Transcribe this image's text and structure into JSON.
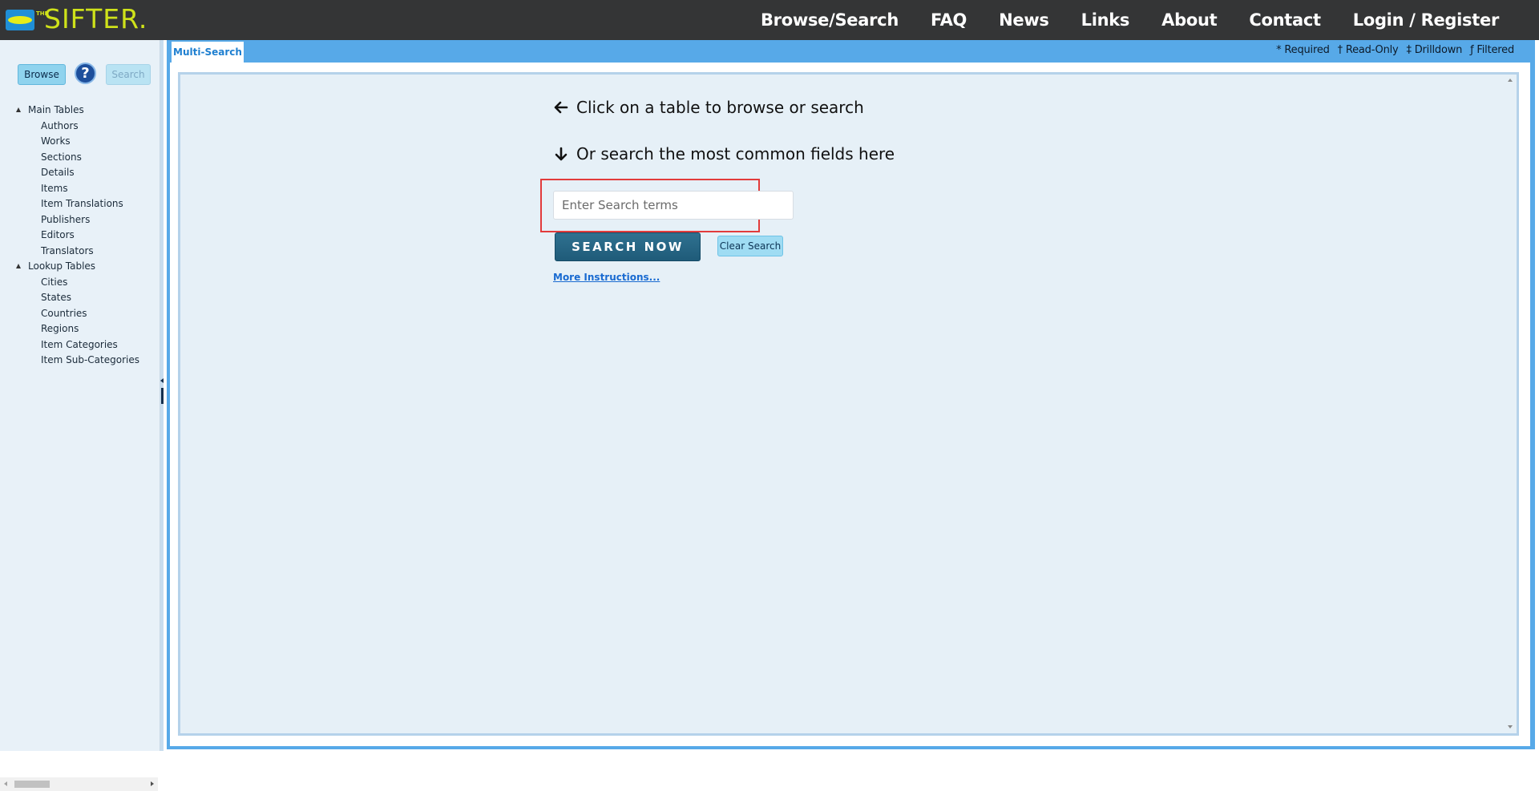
{
  "header": {
    "logo_small": "THE",
    "logo_text": "SIFTER.",
    "nav": [
      "Browse/Search",
      "FAQ",
      "News",
      "Links",
      "About",
      "Contact",
      "Login / Register"
    ]
  },
  "sidebar": {
    "browse_label": "Browse",
    "help_symbol": "?",
    "search_label": "Search",
    "groups": [
      {
        "label": "Main Tables",
        "items": [
          "Authors",
          "Works",
          "Sections",
          "Details",
          "Items",
          "Item Translations",
          "Publishers",
          "Editors",
          "Translators"
        ]
      },
      {
        "label": "Lookup Tables",
        "items": [
          "Cities",
          "States",
          "Countries",
          "Regions",
          "Item Categories",
          "Item Sub-Categories"
        ]
      }
    ]
  },
  "main": {
    "tab_label": "Multi-Search",
    "legend": {
      "required": "* Required",
      "readonly": "† Read-Only",
      "drilldown": "‡ Drilldown",
      "filtered": "ƒ Filtered"
    },
    "hint_browse": "Click on a table to browse or search",
    "hint_search": "Or search the most common fields here",
    "search_placeholder": "Enter Search terms",
    "search_value": "",
    "search_button": "SEARCH NOW",
    "clear_button": "Clear Search",
    "more_link": "More Instructions..."
  },
  "colors": {
    "topbar": "#343536",
    "accent_blue": "#57a9e8",
    "logo_yellow": "#cfe21a",
    "highlight_red": "#e23b3b",
    "search_button": "#1f5b79"
  },
  "icons": [
    "help-icon",
    "arrow-left-icon",
    "arrow-down-icon",
    "tree-expand-icon",
    "scroll-left-icon",
    "scroll-right-icon",
    "scroll-up-icon",
    "scroll-down-icon"
  ]
}
